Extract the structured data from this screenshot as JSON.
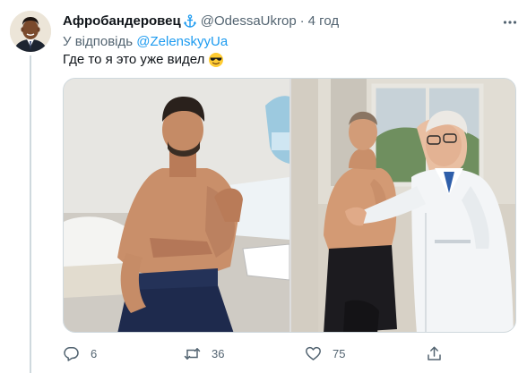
{
  "author": {
    "display_name": "Афробандеровец",
    "badge_icon": "anchor-icon",
    "handle": "@OdessaUkrop",
    "separator": "·",
    "time": "4 год"
  },
  "reply": {
    "prefix": "У відповідь",
    "handle": "@ZelenskyyUa"
  },
  "tweet": {
    "text": "Где то я это уже видел",
    "emoji": "smiling-face-with-sunglasses"
  },
  "media": {
    "count": 2
  },
  "actions": {
    "reply_count": "6",
    "retweet_count": "36",
    "like_count": "75"
  },
  "colors": {
    "accent": "#1d9bf0",
    "secondary_text": "#536471",
    "primary_text": "#0f1419",
    "border": "#cfd9de"
  }
}
